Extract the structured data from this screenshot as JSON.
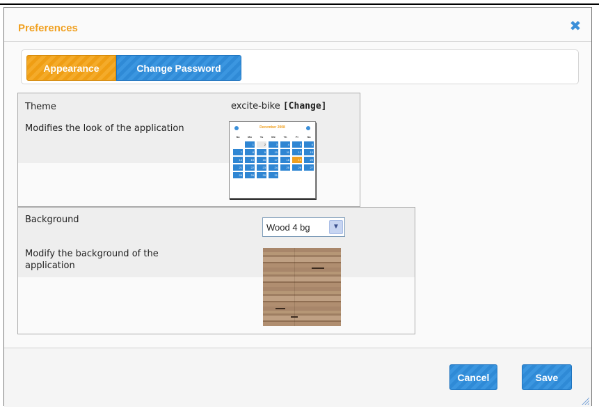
{
  "dialog": {
    "title": "Preferences",
    "close_icon": "close-icon"
  },
  "tabs": [
    {
      "label": "Appearance",
      "active": true
    },
    {
      "label": "Change Password",
      "active": false
    }
  ],
  "theme": {
    "label": "Theme",
    "value": "excite-bike",
    "change_link": "[Change]",
    "description": "Modifies the look of the application",
    "preview": {
      "month": "December 2008",
      "weekdays": [
        "Su",
        "Mo",
        "Tu",
        "We",
        "Th",
        "Fr",
        "Sa"
      ],
      "days": [
        "",
        "1",
        "2",
        "3",
        "4",
        "5",
        "6",
        "7",
        "8",
        "9",
        "10",
        "11",
        "12",
        "13",
        "14",
        "15",
        "16",
        "17",
        "18",
        "19",
        "20",
        "21",
        "22",
        "23",
        "24",
        "25",
        "26",
        "27",
        "28",
        "29",
        "30",
        "31",
        "",
        "",
        ""
      ],
      "today": "2",
      "highlight": "19"
    }
  },
  "background": {
    "label": "Background",
    "selected": "Wood 4 bg",
    "description": "Modify the background of the application"
  },
  "buttons": {
    "cancel": "Cancel",
    "save": "Save"
  },
  "colors": {
    "accent_orange": "#f0a020",
    "accent_blue": "#2f8ad6"
  }
}
